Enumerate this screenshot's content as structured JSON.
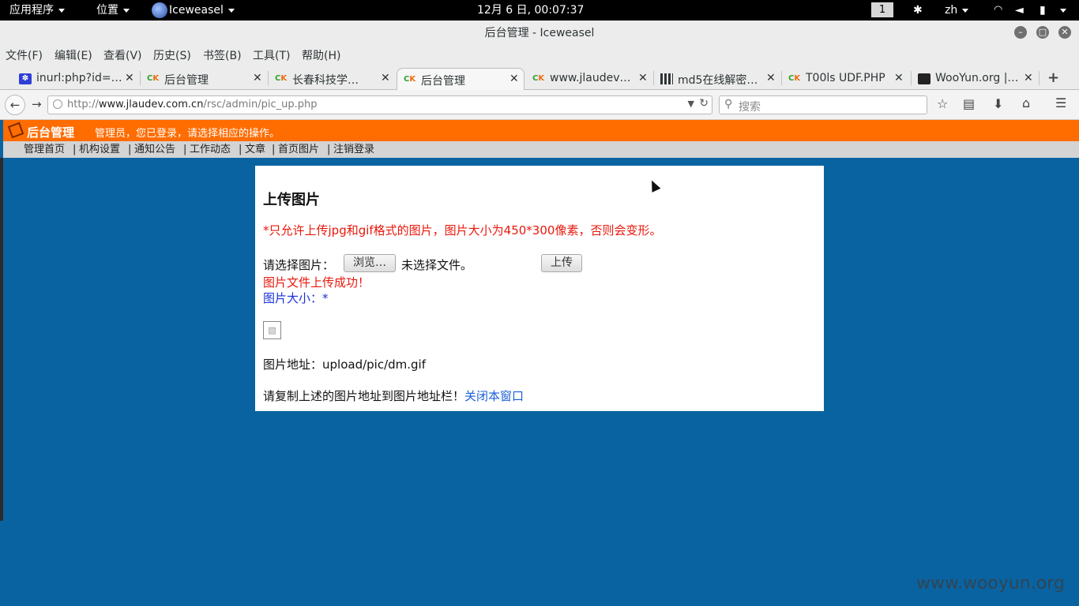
{
  "topbar": {
    "apps_label": "应用程序",
    "places_label": "位置",
    "app_name": "Iceweasel",
    "datetime": "12月  6 日, 00:07:37",
    "workspace": "1",
    "lang": "zh"
  },
  "window": {
    "title": "后台管理 - Iceweasel"
  },
  "menubar": [
    "文件(F)",
    "编辑(E)",
    "查看(V)",
    "历史(S)",
    "书签(B)",
    "工具(T)",
    "帮助(H)"
  ],
  "tabs": [
    {
      "label": "inurl:php?id=…",
      "icon": "paw-icon"
    },
    {
      "label": "后台管理",
      "icon": "ck-icon"
    },
    {
      "label": "长春科技学…",
      "icon": "ck-icon"
    },
    {
      "label": "后台管理",
      "icon": "ck-icon",
      "active": true
    },
    {
      "label": "www.jlaudev…",
      "icon": "ck-icon"
    },
    {
      "label": "md5在线解密…",
      "icon": "grid-icon"
    },
    {
      "label": "T00ls UDF.PHP",
      "icon": "ck-icon"
    },
    {
      "label": "WooYun.org |…",
      "icon": "wooyun-icon"
    }
  ],
  "navbar": {
    "url_prefix": "http://",
    "url_domain": "www.jlaudev.com.cn",
    "url_path": "/rsc/admin/pic_up.php",
    "search_placeholder": "搜索"
  },
  "admin": {
    "logo_text": "后台管理",
    "welcome": "管理员，您已登录，请选择相应的操作。",
    "nav": [
      "管理首页",
      "机构设置",
      "通知公告",
      "工作动态",
      "文章",
      "首页图片",
      "注销登录"
    ]
  },
  "upload": {
    "heading": "上传图片",
    "notice": "*只允许上传jpg和gif格式的图片，图片大小为450*300像素，否则会变形。",
    "choose_label": "请选择图片：",
    "browse_label": "浏览…",
    "no_file": "未选择文件。",
    "submit_label": "上传",
    "success": "图片文件上传成功！",
    "size_label": "图片大小：*",
    "address_label": "图片地址：upload/pic/dm.gif",
    "copy_hint": "请复制上述的图片地址到图片地址栏！",
    "close_link": "关闭本窗口"
  },
  "watermark": "www.wooyun.org",
  "colors": {
    "page_bg": "#0a63a1",
    "admin_header": "#ff6c00",
    "notice_red": "#e8180c",
    "link_blue": "#1a5fd8"
  }
}
